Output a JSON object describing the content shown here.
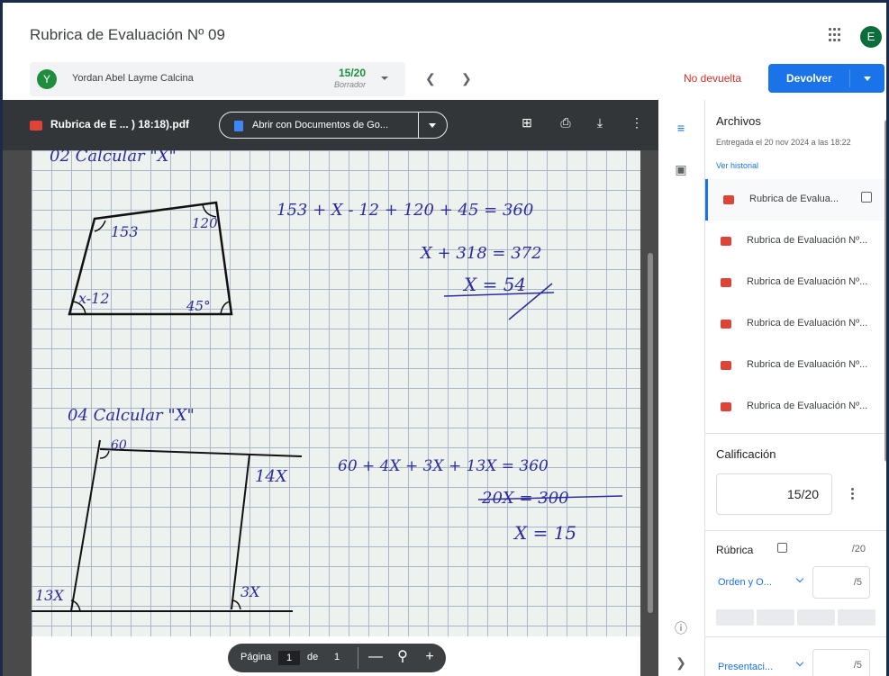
{
  "header": {
    "title": "Rubrica de Evaluación Nº 09",
    "account_initial": "E"
  },
  "student": {
    "initial": "Y",
    "name": "Yordan Abel Layme Calcina",
    "grade": "15/20",
    "status": "Borrador"
  },
  "actions": {
    "not_returned": "No devuelta",
    "return_label": "Devolver"
  },
  "viewer": {
    "file_name": "Rubrica de E ... ) 18:18).pdf",
    "open_with": "Abrir con Documentos de Go...",
    "page_label": "Página",
    "page_current": "1",
    "page_of": "de",
    "page_total": "1"
  },
  "handwriting": {
    "heading_top": "02 Calcular \"X\"",
    "q1_angle_a": "153",
    "q1_angle_b": "120",
    "q1_angle_c": "x-12",
    "q1_angle_d": "45°",
    "q1_eq1": "153 + X - 12 + 120 + 45 = 360",
    "q1_eq2": "X + 318 = 372",
    "q1_eq3": "X = 54",
    "heading_q2": "04 Calcular \"X\"",
    "q2_angle_a": "60",
    "q2_angle_b": "14X",
    "q2_angle_c": "13X",
    "q2_angle_d": "3X",
    "q2_eq1": "60 + 4X + 3X + 13X = 360",
    "q2_eq2": "20X = 300",
    "q2_eq3": "X = 15"
  },
  "panel": {
    "files_title": "Archivos",
    "submitted": "Entregada el 20 nov 2024 a las 18:22",
    "history": "Ver historial",
    "files": [
      "Rubrica de Evalua...",
      "Rubrica de Evaluación Nº...",
      "Rubrica de Evaluación Nº...",
      "Rubrica de Evaluación Nº...",
      "Rubrica de Evaluación Nº...",
      "Rubrica de Evaluación Nº..."
    ],
    "grading_title": "Calificación",
    "grade_value": "15/20",
    "rubric_title": "Rúbrica",
    "rubric_total": "/20",
    "criteria": [
      {
        "name": "Orden y O...",
        "max": "/5"
      },
      {
        "name": "Presentaci...",
        "max": "/5"
      }
    ]
  },
  "colors": {
    "accent": "#1a73e8",
    "danger": "#d93025",
    "grade_green": "#1e8e3e",
    "viewer_toolbar": "#323639"
  }
}
